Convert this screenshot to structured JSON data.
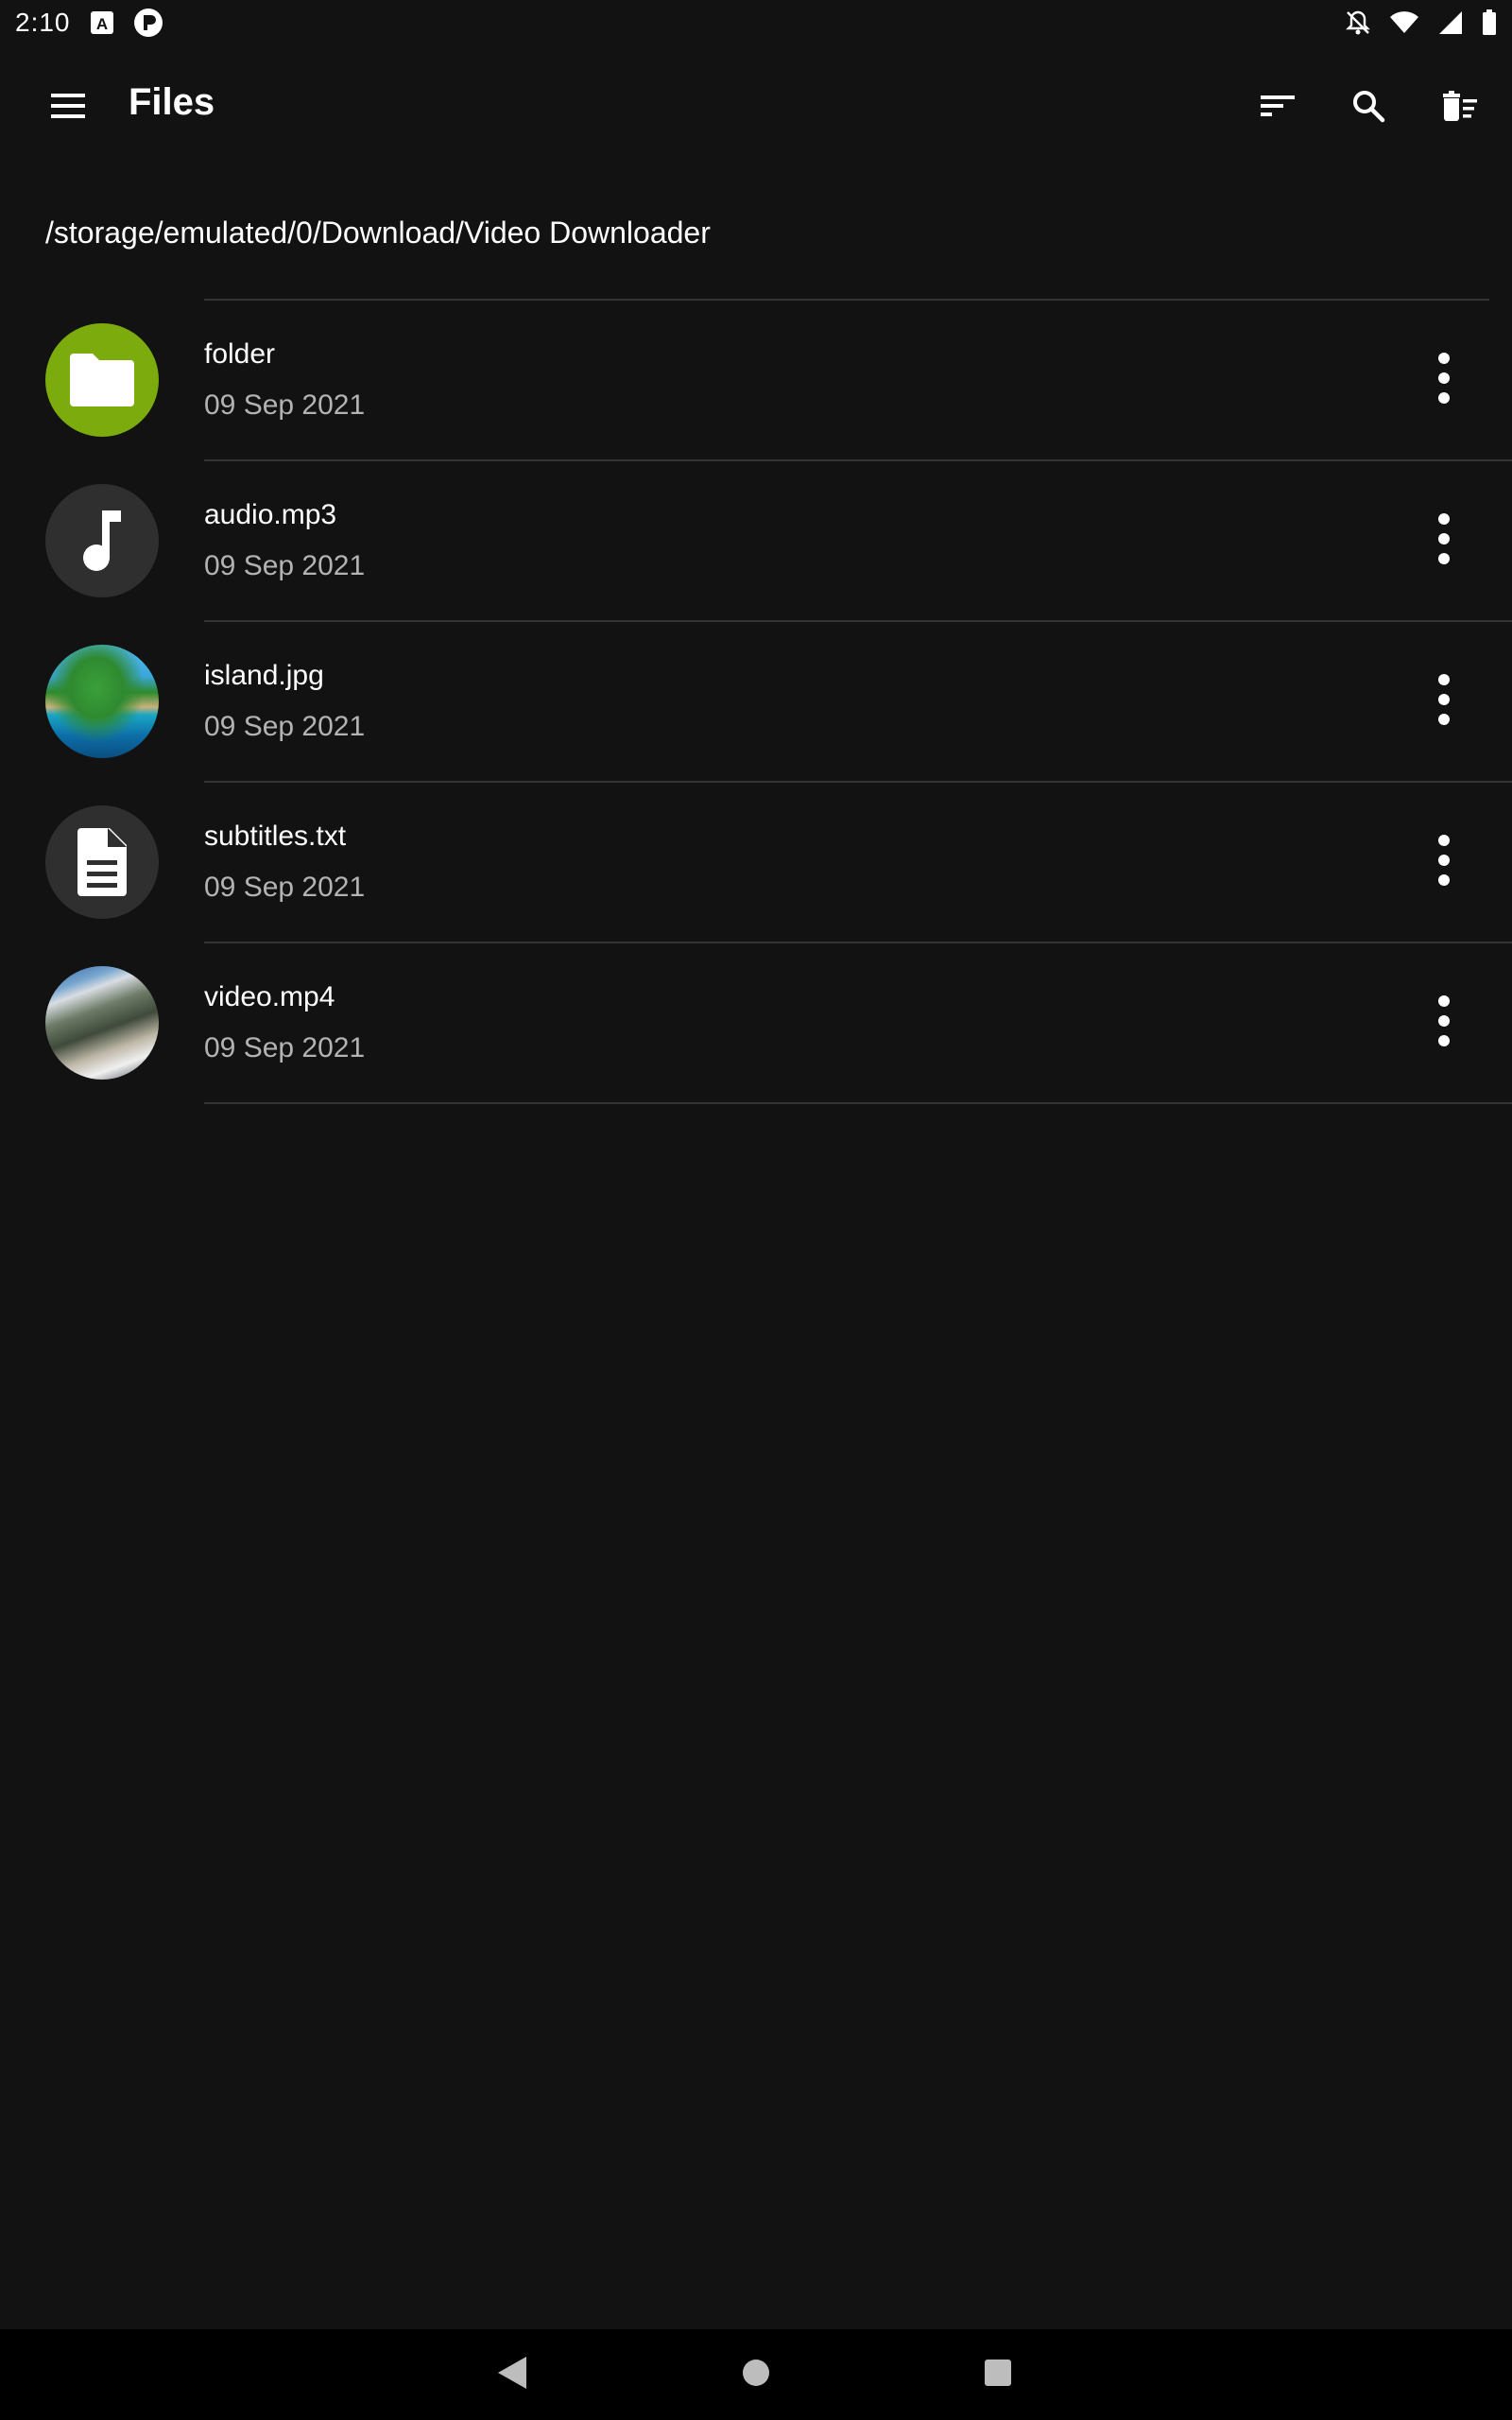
{
  "status_bar": {
    "time": "2:10"
  },
  "app_bar": {
    "title": "Files"
  },
  "path": "/storage/emulated/0/Download/Video Downloader",
  "files": [
    {
      "name": "folder",
      "date": "09 Sep 2021",
      "icon": "folder-icon",
      "color": "#7cab0d"
    },
    {
      "name": "audio.mp3",
      "date": "09 Sep 2021",
      "icon": "music-note-icon",
      "color": "#2f2f2f"
    },
    {
      "name": "island.jpg",
      "date": "09 Sep 2021",
      "icon": "image-thumbnail"
    },
    {
      "name": "subtitles.txt",
      "date": "09 Sep 2021",
      "icon": "document-icon",
      "color": "#2f2f2f"
    },
    {
      "name": "video.mp4",
      "date": "09 Sep 2021",
      "icon": "video-thumbnail"
    }
  ],
  "colors": {
    "background": "#121212",
    "divider": "#333333",
    "secondary_text": "#b3b3b3",
    "folder_accent": "#7cab0d"
  }
}
